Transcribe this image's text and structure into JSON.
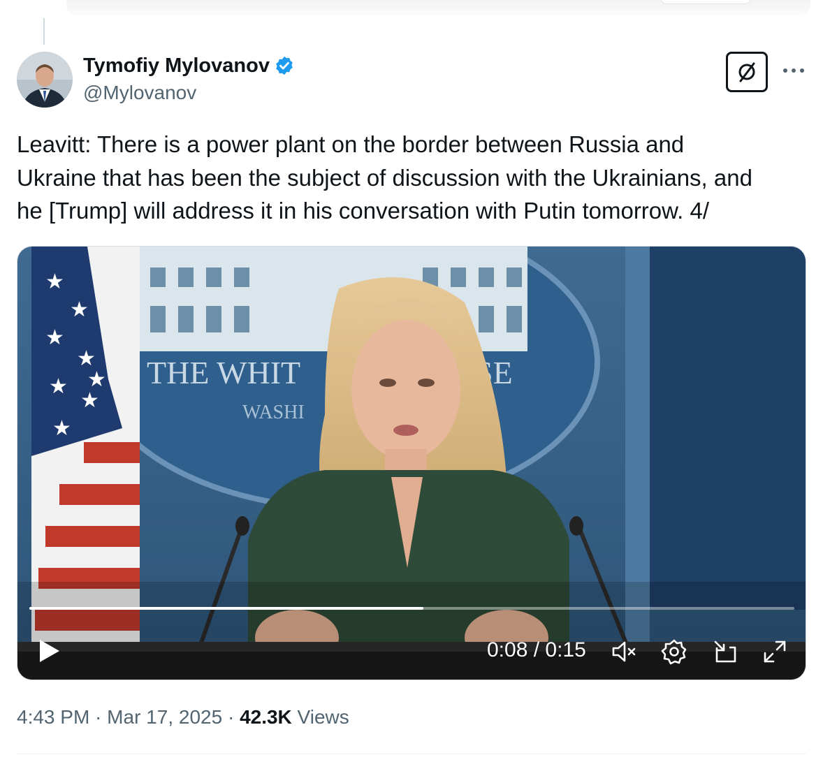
{
  "author": {
    "display_name": "Tymofiy Mylovanov",
    "handle": "@Mylovanov",
    "verified": true
  },
  "tweet": {
    "text": "Leavitt: There is a power plant on the border between Russia and\nUkraine that has been the subject of discussion with the Ukrainians, and\nhe [Trump] will address it in his conversation with Putin tomorrow. 4/"
  },
  "video": {
    "current_time": "0:08",
    "duration": "0:15",
    "time_display": "0:08 / 0:15",
    "progress_fraction": 0.515,
    "backdrop_seal_text": "THE WHIT",
    "backdrop_seal_text_right": "SE",
    "backdrop_seal_subtext": "WASHI",
    "icons": [
      "play-icon",
      "mute-icon",
      "settings-icon",
      "pip-icon",
      "fullscreen-icon"
    ]
  },
  "meta": {
    "time": "4:43 PM",
    "separator": " · ",
    "date": "Mar 17, 2025",
    "views_count": "42.3K",
    "views_label": " Views"
  },
  "colors": {
    "text_primary": "#0f1419",
    "text_secondary": "#536471",
    "verified_blue": "#1d9bf0"
  }
}
